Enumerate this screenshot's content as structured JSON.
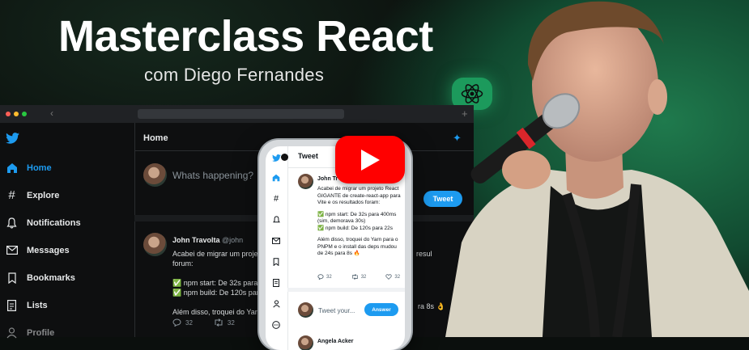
{
  "thumbnail": {
    "title": "Masterclass React",
    "subtitle": "com Diego Fernandes"
  },
  "browser": {
    "nav_back": "‹",
    "new_tab": "+"
  },
  "sidebar": {
    "items": [
      {
        "label": "Home",
        "icon": "home-icon",
        "active": true
      },
      {
        "label": "Explore",
        "icon": "hash-icon"
      },
      {
        "label": "Notifications",
        "icon": "bell-icon"
      },
      {
        "label": "Messages",
        "icon": "mail-icon"
      },
      {
        "label": "Bookmarks",
        "icon": "bookmark-icon"
      },
      {
        "label": "Lists",
        "icon": "list-icon"
      },
      {
        "label": "Profile",
        "icon": "user-icon"
      }
    ]
  },
  "main": {
    "header": "Home",
    "compose_placeholder": "Whats happening?",
    "tweet_button": "Tweet",
    "post": {
      "name": "John Travolta",
      "handle": "@john",
      "lines": [
        "Acabei de migrar um projet",
        "forum:",
        "",
        "✅ npm start: De 32s para",
        "✅ npm build: De 120s para",
        "",
        "Além disso, troquei do Yarn"
      ],
      "peek_right_1": "resul",
      "peek_right_2": "ra 8s 👌",
      "comments": "32",
      "retweets": "32"
    }
  },
  "phone": {
    "title": "Tweet",
    "name": "John Tr",
    "body": [
      "Acabei de migrar um projeto React GIGANTE de create-react-app para Vite e os resultados foram:",
      "✅ npm start: De 32s para 400ms (sim, demorava 30s)\n✅ npm build: De 120s para 22s",
      "Além disso, troquei do Yarn para o PNPM e o install das deps mudou de 24s para 8s 🔥"
    ],
    "comments": "32",
    "retweets": "32",
    "likes": "32",
    "reply_placeholder": "Tweet your...",
    "answer_button": "Answer",
    "next_name": "Angela Acker"
  },
  "colors": {
    "accent": "#1d9bf0",
    "youtube": "#ff0000",
    "react_badge": "#1c9a5c"
  }
}
